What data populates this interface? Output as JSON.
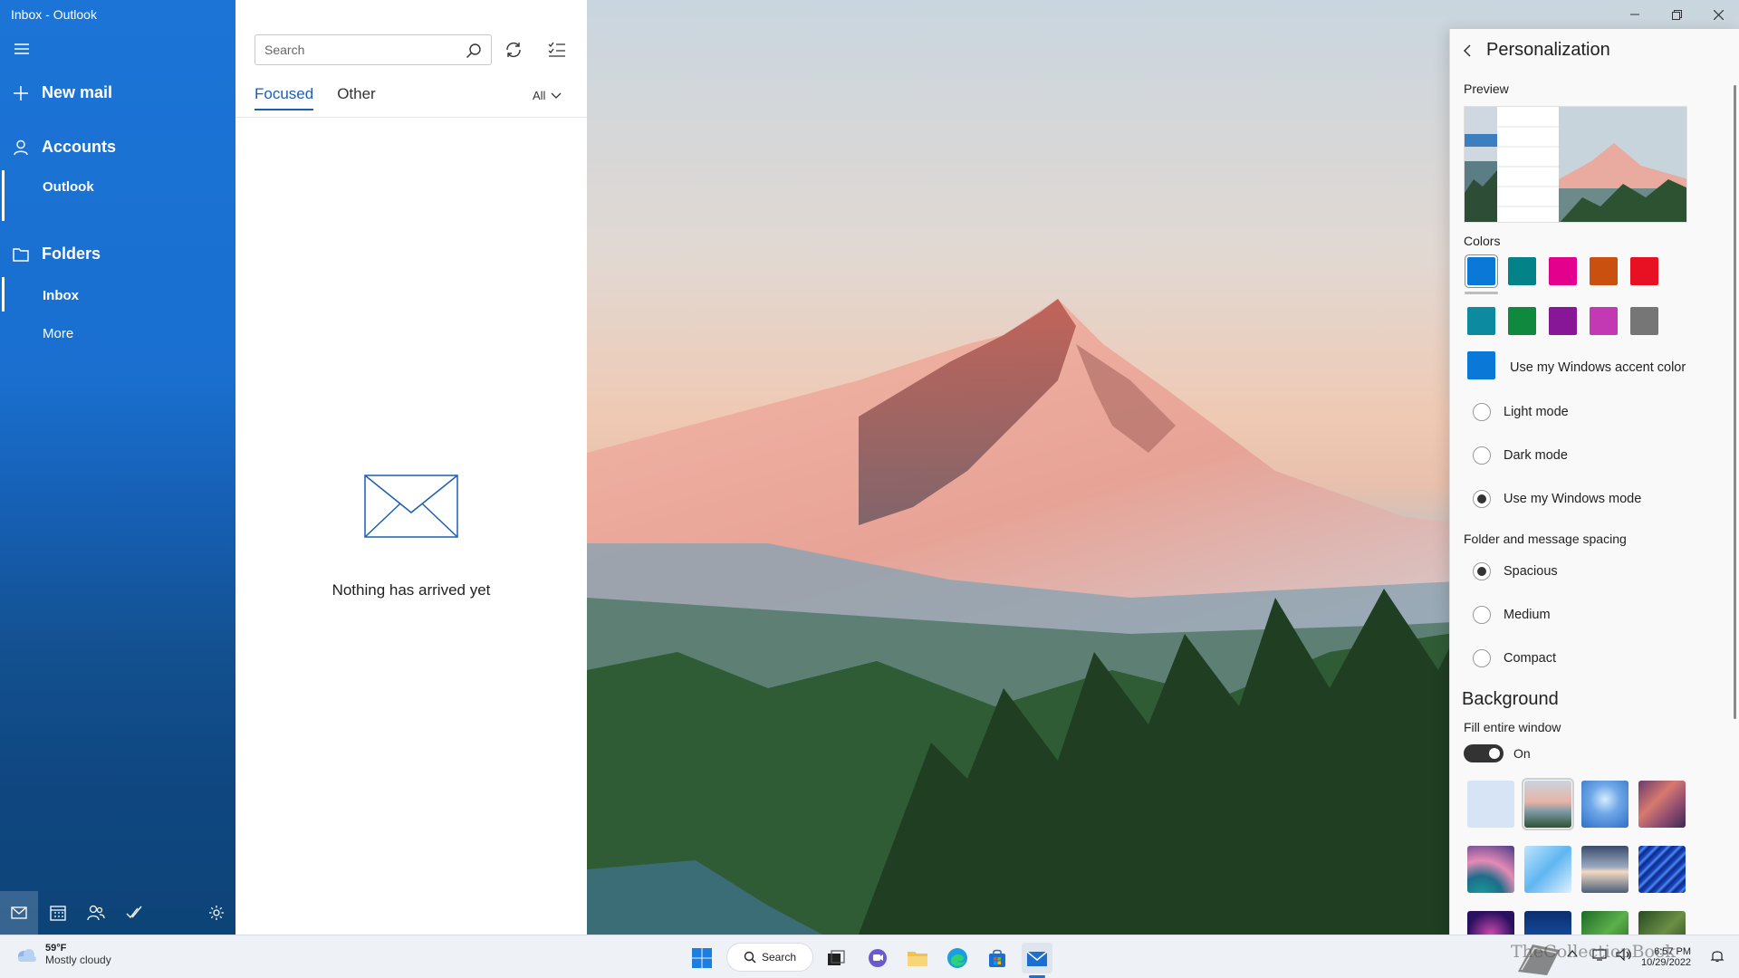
{
  "window": {
    "title": "Inbox - Outlook"
  },
  "nav": {
    "new_mail": "New mail",
    "accounts": "Accounts",
    "account_name": "Outlook",
    "folders": "Folders",
    "inbox": "Inbox",
    "more": "More"
  },
  "list": {
    "search_placeholder": "Search",
    "tab_focused": "Focused",
    "tab_other": "Other",
    "filter": "All",
    "empty_message": "Nothing has arrived yet"
  },
  "panel": {
    "title": "Personalization",
    "preview_label": "Preview",
    "colors_label": "Colors",
    "colors_row1": [
      "#0a78d7",
      "#038387",
      "#e3008c",
      "#ca5010",
      "#e81123"
    ],
    "colors_row2": [
      "#0c8aa0",
      "#10893e",
      "#881798",
      "#c239b3",
      "#767676"
    ],
    "windows_accent_color": "#0a78d7",
    "use_windows_accent": "Use my Windows accent color",
    "light_mode": "Light mode",
    "dark_mode": "Dark mode",
    "windows_mode": "Use my Windows mode",
    "spacing_label": "Folder and message spacing",
    "spacious": "Spacious",
    "medium": "Medium",
    "compact": "Compact",
    "background_label": "Background",
    "fill_label": "Fill entire window",
    "toggle_state": "On"
  },
  "taskbar": {
    "temperature": "59°F",
    "condition": "Mostly cloudy",
    "search": "Search",
    "time": "6:57 PM",
    "date": "10/29/2022"
  },
  "watermark": "TheCollectionBook"
}
